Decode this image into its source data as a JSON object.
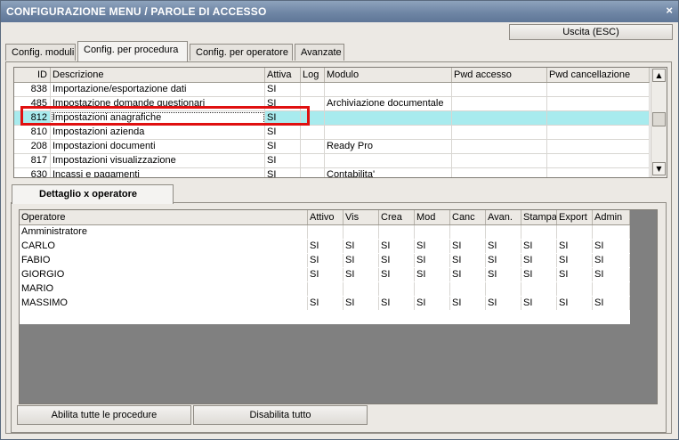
{
  "window": {
    "title": "CONFIGURAZIONE MENU / PAROLE DI ACCESSO",
    "close_glyph": "×"
  },
  "toolbar": {
    "exit_label": "Uscita (ESC)"
  },
  "tabs": [
    {
      "label": "Config. moduli"
    },
    {
      "label": "Config. per procedura"
    },
    {
      "label": "Config. per operatore"
    },
    {
      "label": "Avanzate"
    }
  ],
  "procedures": {
    "columns": [
      "ID",
      "Descrizione",
      "Attiva",
      "Log",
      "Modulo",
      "Pwd accesso",
      "Pwd cancellazione"
    ],
    "rows": [
      {
        "id": "838",
        "descrizione": "Importazione/esportazione dati",
        "attiva": "SI",
        "log": "",
        "modulo": "",
        "pwd_accesso": "",
        "pwd_cancellazione": ""
      },
      {
        "id": "485",
        "descrizione": "Impostazione domande questionari",
        "attiva": "SI",
        "log": "",
        "modulo": "Archiviazione documentale",
        "pwd_accesso": "",
        "pwd_cancellazione": ""
      },
      {
        "id": "812",
        "descrizione": "Impostazioni anagrafiche",
        "attiva": "SI",
        "log": "",
        "modulo": "",
        "pwd_accesso": "",
        "pwd_cancellazione": "",
        "selected": true
      },
      {
        "id": "810",
        "descrizione": "Impostazioni azienda",
        "attiva": "SI",
        "log": "",
        "modulo": "",
        "pwd_accesso": "",
        "pwd_cancellazione": ""
      },
      {
        "id": "208",
        "descrizione": "Impostazioni documenti",
        "attiva": "SI",
        "log": "",
        "modulo": "Ready Pro",
        "pwd_accesso": "",
        "pwd_cancellazione": ""
      },
      {
        "id": "817",
        "descrizione": "Impostazioni visualizzazione",
        "attiva": "SI",
        "log": "",
        "modulo": "",
        "pwd_accesso": "",
        "pwd_cancellazione": ""
      },
      {
        "id": "630",
        "descrizione": "Incassi e pagamenti",
        "attiva": "SI",
        "log": "",
        "modulo": "Contabilita'",
        "pwd_accesso": "",
        "pwd_cancellazione": ""
      }
    ],
    "highlight_color": "#e01010",
    "selected_row_color": "#a8ebee"
  },
  "detail": {
    "tab_label": "Dettaglio x operatore",
    "columns": [
      "Operatore",
      "Attivo",
      "Vis",
      "Crea",
      "Mod",
      "Canc",
      "Avan.",
      "Stampa",
      "Export",
      "Admin"
    ],
    "rows": [
      {
        "operatore": "Amministratore",
        "vals": [
          "",
          "",
          "",
          "",
          "",
          "",
          "",
          "",
          ""
        ]
      },
      {
        "operatore": "CARLO",
        "vals": [
          "SI",
          "SI",
          "SI",
          "SI",
          "SI",
          "SI",
          "SI",
          "SI",
          "SI"
        ]
      },
      {
        "operatore": "FABIO",
        "vals": [
          "SI",
          "SI",
          "SI",
          "SI",
          "SI",
          "SI",
          "SI",
          "SI",
          "SI"
        ]
      },
      {
        "operatore": "GIORGIO",
        "vals": [
          "SI",
          "SI",
          "SI",
          "SI",
          "SI",
          "SI",
          "SI",
          "SI",
          "SI"
        ]
      },
      {
        "operatore": "MARIO",
        "vals": [
          "",
          "",
          "",
          "",
          "",
          "",
          "",
          "",
          ""
        ]
      },
      {
        "operatore": "MASSIMO",
        "vals": [
          "SI",
          "SI",
          "SI",
          "SI",
          "SI",
          "SI",
          "SI",
          "SI",
          "SI"
        ]
      }
    ]
  },
  "buttons": {
    "enable_all": "Abilita tutte le procedure",
    "disable_all": "Disabilita tutto"
  },
  "colors": {
    "titlebar": "#6f86a5",
    "highlight": "#e01010",
    "selected_row": "#a8ebee"
  }
}
